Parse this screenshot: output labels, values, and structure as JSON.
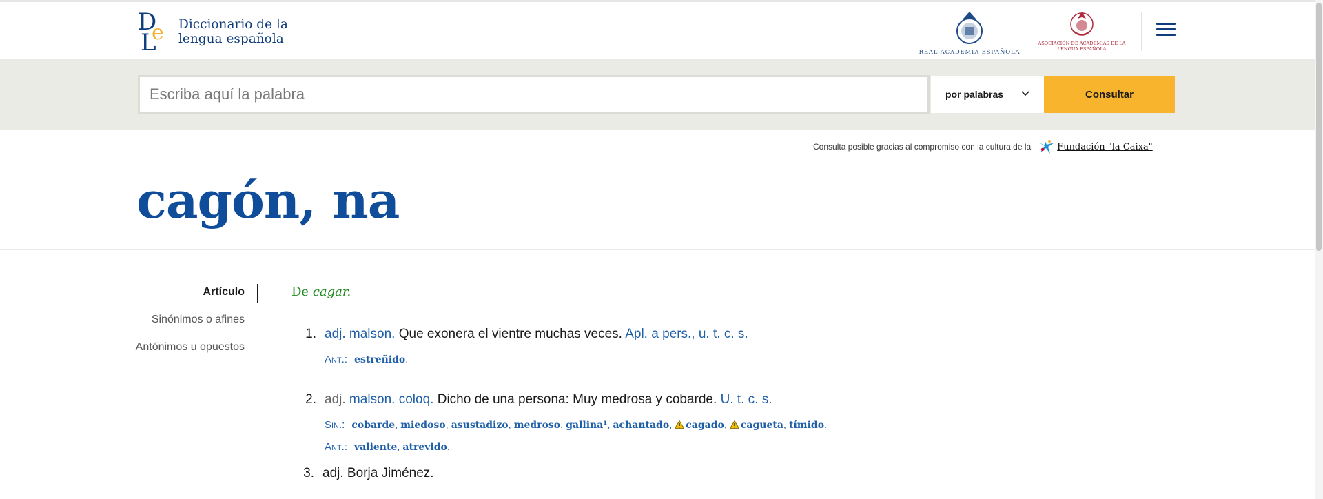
{
  "header": {
    "logo_text_line1": "Diccionario de la",
    "logo_text_line2": "lengua española",
    "rae_label": "REAL ACADEMIA ESPAÑOLA",
    "asale_label_line1": "ASOCIACIÓN DE ACADEMIAS DE LA",
    "asale_label_line2": "LENGUA ESPAÑOLA",
    "brand_color": "#0f3c7a"
  },
  "search": {
    "placeholder": "Escriba aquí la palabra",
    "value": "",
    "mode": "por palabras",
    "button_label": "Consultar",
    "button_color": "#f8b42c"
  },
  "sponsor": {
    "text": "Consulta posible gracias al compromiso con la cultura de la",
    "name": "Fundación \"la Caixa\""
  },
  "entry": {
    "headword": "cagón, na",
    "etymology_prefix": "De",
    "etymology_word": "cagar."
  },
  "sidebar": {
    "items": [
      {
        "label": "Artículo",
        "active": true
      },
      {
        "label": "Sinónimos o afines",
        "active": false
      },
      {
        "label": "Antónimos u opuestos",
        "active": false
      }
    ]
  },
  "senses": [
    {
      "num": "1.",
      "abbr": "adj. malson.",
      "definition": "Que exonera el vientre muchas veces.",
      "usage": "Apl. a pers., u. t. c. s.",
      "ant_label": "Ant.:",
      "antonyms": [
        "estreñido"
      ]
    },
    {
      "num": "2.",
      "abbr_grey": "adj.",
      "abbr": "malson. coloq.",
      "definition": "Dicho de una persona: Muy medrosa y cobarde.",
      "usage": "U. t. c. s.",
      "syn_label": "Sin.:",
      "synonyms": [
        "cobarde",
        "miedoso",
        "asustadizo",
        "medroso",
        "gallina¹",
        "achantado",
        "cagado",
        "cagueta",
        "tímido"
      ],
      "ant_label": "Ant.:",
      "antonyms": [
        "valiente",
        "atrevido"
      ]
    },
    {
      "num": "3.",
      "text": "adj. Borja Jiménez."
    }
  ],
  "icons": {
    "menu": "hamburger-menu-icon",
    "select": "chevron-down-icon",
    "warning": "warning-triangle-icon",
    "sponsor": "caixa-star-icon"
  }
}
